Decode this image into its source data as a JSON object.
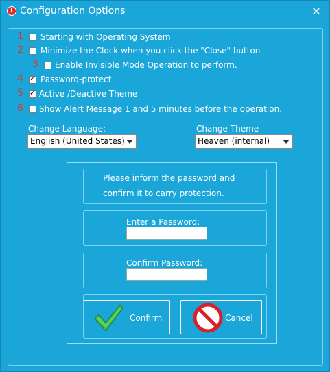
{
  "window": {
    "title": "Configuration Options",
    "close_glyph": "✕"
  },
  "options": [
    {
      "num": "1",
      "label": "Starting with Operating System",
      "checked": false
    },
    {
      "num": "2",
      "label": "Minimize the Clock when you click the \"Close\" button",
      "checked": false
    },
    {
      "num": "3",
      "label": "Enable Invisible Mode Operation to perform.",
      "checked": false
    },
    {
      "num": "4",
      "label": "Password-protect",
      "checked": true
    },
    {
      "num": "5",
      "label": "Active /Deactive  Theme",
      "checked": true
    },
    {
      "num": "6",
      "label": "Show Alert Message 1 and 5 minutes before the operation.",
      "checked": false
    }
  ],
  "language": {
    "label": "Change Language:",
    "value": "English (United States)"
  },
  "theme": {
    "label": "Change Theme",
    "value": "Heaven (internal)"
  },
  "password": {
    "info_line1": "Please inform the password and",
    "info_line2": "confirm it to carry protection.",
    "enter_label": "Enter a Password:",
    "confirm_label": "Confirm Password:",
    "enter_value": "",
    "confirm_value": ""
  },
  "buttons": {
    "confirm": "Confirm",
    "cancel": "Cancel"
  },
  "colors": {
    "accent": "#1aa6d9",
    "number_red": "#e0302a",
    "check_green": "#3bb84a",
    "cancel_red": "#d8202a"
  }
}
